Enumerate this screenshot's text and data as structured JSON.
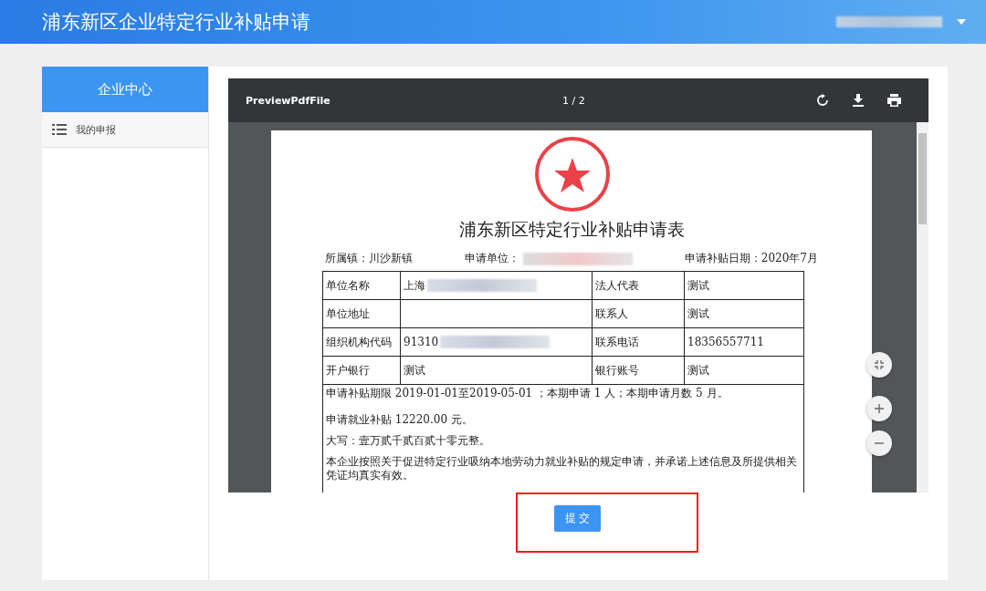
{
  "header": {
    "title": "浦东新区企业特定行业补贴申请"
  },
  "sidebar": {
    "title": "企业中心",
    "items": [
      {
        "label": "我的申报"
      }
    ]
  },
  "pdf_viewer": {
    "title": "PreviewPdfFile",
    "page_indicator": "1 / 2",
    "document": {
      "title": "浦东新区特定行业补贴申请表",
      "meta": [
        {
          "kind": "text",
          "text": "所属镇：川沙新镇"
        },
        {
          "kind": "redacted",
          "text": "申请单位："
        },
        {
          "kind": "text",
          "text": "申请补贴日期：2020年7月"
        }
      ],
      "rows": [
        [
          {
            "kind": "text",
            "text": "单位名称"
          },
          {
            "kind": "redacted",
            "text": "上海"
          },
          {
            "kind": "text",
            "text": "法人代表"
          },
          {
            "kind": "text",
            "text": "测试"
          }
        ],
        [
          {
            "kind": "text",
            "text": "单位地址"
          },
          {
            "kind": "empty"
          },
          {
            "kind": "text",
            "text": "联系人"
          },
          {
            "kind": "text",
            "text": "测试"
          }
        ],
        [
          {
            "kind": "text",
            "text": "组织机构代码"
          },
          {
            "kind": "redacted",
            "text": "91310"
          },
          {
            "kind": "text",
            "text": "联系电话"
          },
          {
            "kind": "text",
            "text": "18356557711"
          }
        ],
        [
          {
            "kind": "text",
            "text": "开户银行"
          },
          {
            "kind": "text",
            "text": "测试"
          },
          {
            "kind": "text",
            "text": "银行账号"
          },
          {
            "kind": "text",
            "text": "测试"
          }
        ]
      ],
      "paragraphs": [
        "申请补贴期限 2019-01-01至2019-05-01 ；本期申请 1 人；本期申请月数 5 月。",
        "申请就业补贴 12220.00 元。",
        "大写：壹万贰千贰百贰十零元整。",
        "本企业按照关于促进特定行业吸纳本地劳动力就业补贴的规定申请，并承诺上述信息及所提供相关凭证均真实有效。"
      ]
    }
  },
  "submit_button": {
    "label": "提 交"
  }
}
